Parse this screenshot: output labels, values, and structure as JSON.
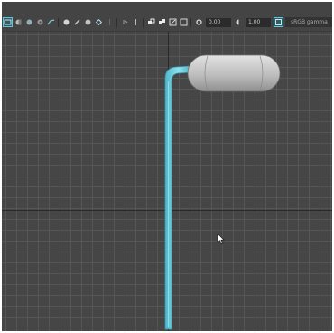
{
  "toolbar": {
    "icons": [
      "camera-select-icon",
      "camera-attributes-icon",
      "bookmark-icon",
      "image-plane-icon",
      "grid-toggle-icon",
      "film-gate-icon",
      "resolution-gate-icon",
      "gate-mask-icon",
      "field-chart-icon",
      "safe-action-icon",
      "safe-title-icon",
      "wireframe-icon",
      "smooth-shade-icon",
      "textured-icon",
      "use-lights-icon",
      "shadows-icon",
      "isolate-select-icon",
      "xray-icon",
      "xray-joints-icon",
      "backface-icon"
    ],
    "exposure_value": "0.00",
    "gamma_value": "1.00",
    "color_space": "sRGB gamma",
    "accent_color": "#5fc8d8"
  },
  "scene": {
    "object_colors": {
      "cylinder": "#d0d0d0",
      "tube": "#6fd3e6"
    }
  }
}
